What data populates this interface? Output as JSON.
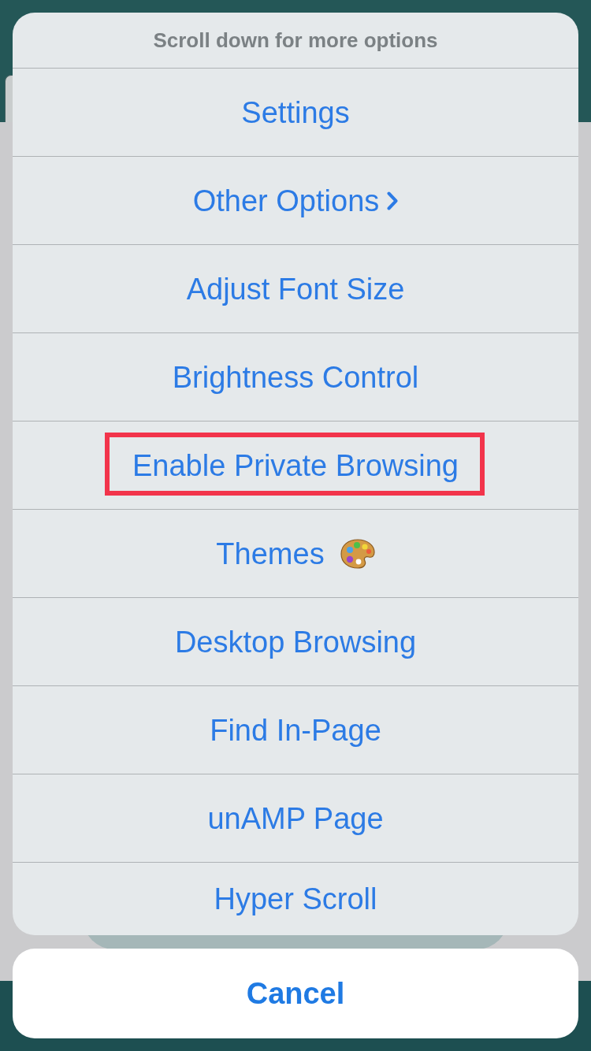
{
  "action_sheet": {
    "message": "Scroll down for more options",
    "items": [
      {
        "label": "Settings",
        "kind": "plain",
        "highlighted": false
      },
      {
        "label": "Other Options",
        "kind": "submenu",
        "highlighted": false
      },
      {
        "label": "Adjust Font Size",
        "kind": "plain",
        "highlighted": false
      },
      {
        "label": "Brightness Control",
        "kind": "plain",
        "highlighted": false
      },
      {
        "label": "Enable Private Browsing",
        "kind": "plain",
        "highlighted": true
      },
      {
        "label": "Themes",
        "kind": "emoji",
        "highlighted": false
      },
      {
        "label": "Desktop Browsing",
        "kind": "plain",
        "highlighted": false
      },
      {
        "label": "Find In-Page",
        "kind": "plain",
        "highlighted": false
      },
      {
        "label": "unAMP Page",
        "kind": "plain",
        "highlighted": false
      },
      {
        "label": "Hyper Scroll",
        "kind": "plain",
        "highlighted": false
      }
    ]
  },
  "cancel_button": {
    "label": "Cancel"
  }
}
